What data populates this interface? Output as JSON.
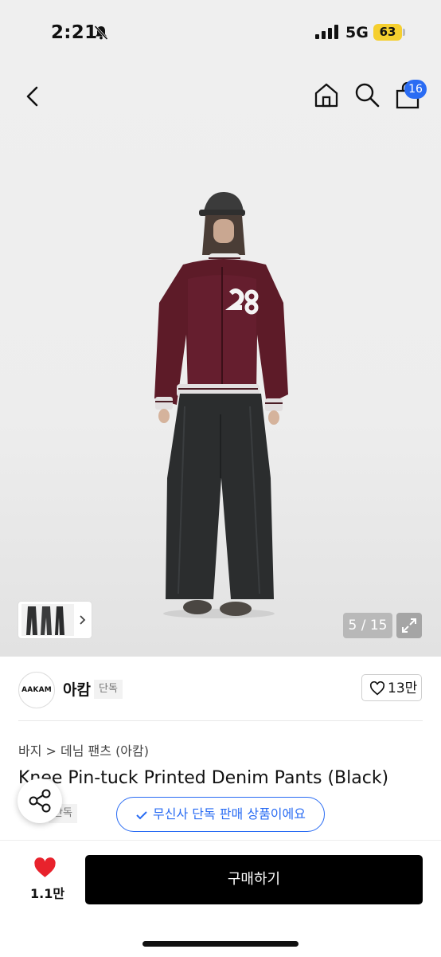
{
  "status": {
    "time": "2:21",
    "network": "5G",
    "battery": "63"
  },
  "nav": {
    "cart_count": "16"
  },
  "gallery": {
    "counter": "5 / 15"
  },
  "brand": {
    "logo_text": "AAKAM",
    "name": "아캄",
    "tag": "단독",
    "like_count": "13만"
  },
  "product": {
    "breadcrumb": "바지 > 데님 팬츠 (아캄)",
    "title": "Knee Pin-tuck Printed Denim Pants (Black)",
    "tag": "단독",
    "exclusive_notice": "무신사 단독 판매 상품이에요"
  },
  "bottom": {
    "like_count": "1.1만",
    "buy_label": "구매하기"
  },
  "colors": {
    "accent": "#2a6cf3",
    "heart": "#e8222c",
    "battery": "#f5cf2f"
  }
}
